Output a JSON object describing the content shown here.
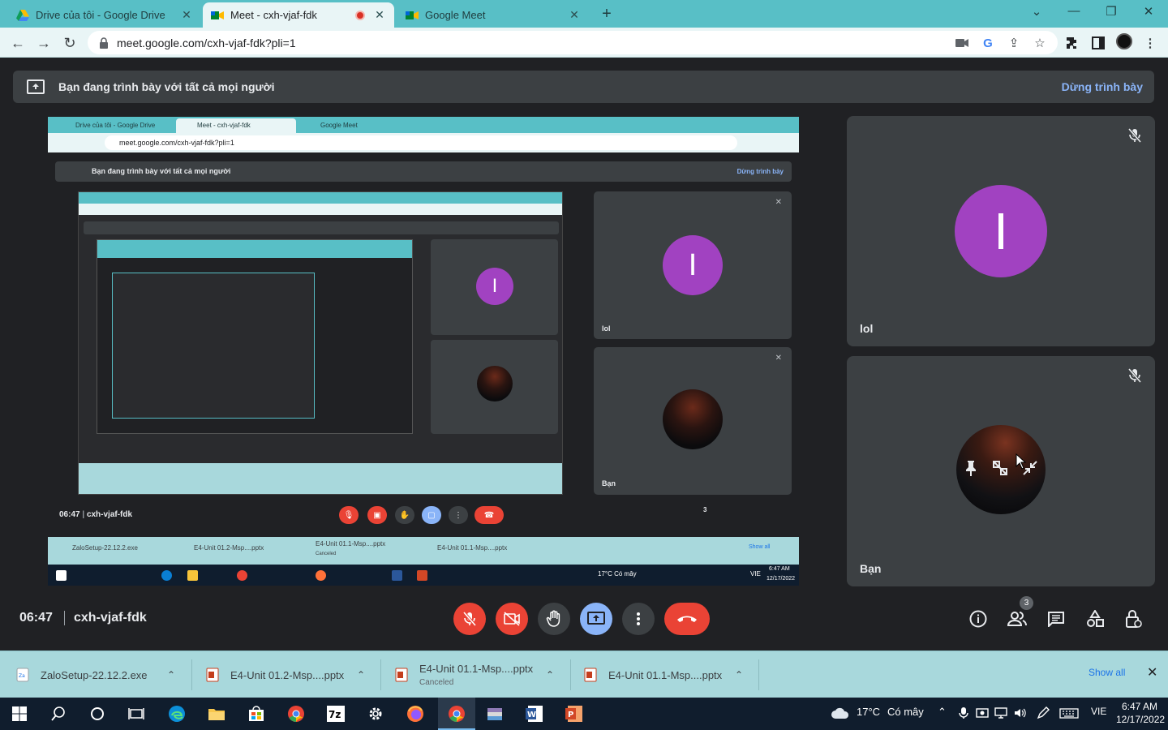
{
  "browser": {
    "tabs": [
      {
        "title": "Drive của tôi - Google Drive",
        "close": "✕"
      },
      {
        "title": "Meet - cxh-vjaf-fdk",
        "close": "✕",
        "recording": true
      },
      {
        "title": "Google Meet",
        "close": "✕"
      }
    ],
    "new_tab": "+",
    "window_controls": {
      "dropdown": "⌄",
      "minimize": "—",
      "maximize": "❐",
      "close": "✕"
    },
    "url": "meet.google.com/cxh-vjaf-fdk?pli=1"
  },
  "banner": {
    "text": "Bạn đang trình bày với tất cả mọi người",
    "stop_label": "Dừng trình bày"
  },
  "shared_screen": {
    "tabs": [
      "Drive của tôi - Google Drive",
      "Meet - cxh-vjaf-fdk",
      "Google Meet"
    ],
    "url": "meet.google.com/cxh-vjaf-fdk?pli=1",
    "banner_text": "Bạn đang trình bày với tất cả mọi người",
    "stop_label": "Dừng trình bày",
    "tile1_name": "lol",
    "tile2_name": "Bạn",
    "avatar_letter": "I",
    "clock": "06:47",
    "code": "cxh-vjaf-fdk",
    "badge": "3",
    "downloads": [
      "ZaloSetup-22.12.2.exe",
      "E4-Unit 01.2-Msp....pptx",
      "E4-Unit 01.1-Msp....pptx",
      "E4-Unit 01.1-Msp....pptx"
    ],
    "download_status": "Canceled",
    "show_all": "Show all",
    "weather": "17°C  Có mây",
    "lang": "VIE",
    "time": "6:47 AM",
    "date": "12/17/2022"
  },
  "participants": [
    {
      "name": "lol",
      "avatar_letter": "I",
      "avatar_color": "#a142c1",
      "muted": true
    },
    {
      "name": "Bạn",
      "muted": true
    }
  ],
  "meeting": {
    "time": "06:47",
    "code": "cxh-vjaf-fdk",
    "people_count": "3"
  },
  "downloads": {
    "items": [
      {
        "name": "ZaloSetup-22.12.2.exe",
        "status": ""
      },
      {
        "name": "E4-Unit 01.2-Msp....pptx",
        "status": ""
      },
      {
        "name": "E4-Unit 01.1-Msp....pptx",
        "status": "Canceled"
      },
      {
        "name": "E4-Unit 01.1-Msp....pptx",
        "status": ""
      }
    ],
    "show_all": "Show all",
    "close": "✕"
  },
  "taskbar": {
    "weather": "17°C",
    "weather_desc": "Có mây",
    "language": "VIE",
    "time": "6:47 AM",
    "date": "12/17/2022"
  },
  "colors": {
    "chrome_frame": "#58bfc6",
    "meet_bg": "#202124",
    "tile_bg": "#3c4043",
    "danger": "#ea4335",
    "accent": "#8ab4f8",
    "avatar": "#a142c1"
  }
}
